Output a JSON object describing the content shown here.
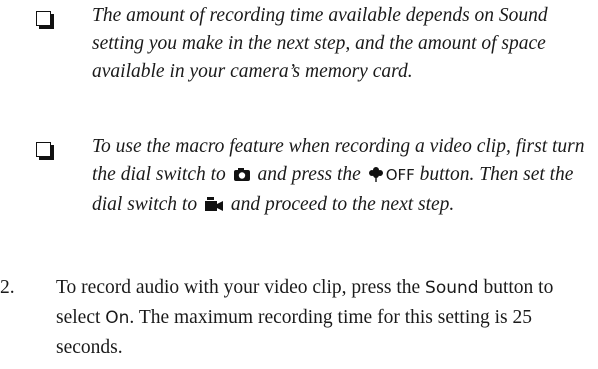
{
  "notes": [
    {
      "text": "The amount of recording time available depends on Sound setting you make in the next step, and the amount of space available in your camera’s memory card."
    },
    {
      "text_before": "To use the macro feature when recording a video clip, first turn the dial switch to",
      "icon_camera": "camera-mode-icon",
      "text_mid": "and press the",
      "icon_macro": "macro-flower-icon",
      "button_label": "OFF",
      "text_after": "button. Then set the dial switch to",
      "icon_video": "video-mode-icon",
      "text_end": "and proceed to the next step."
    }
  ],
  "step": {
    "number": "2.",
    "text_start": "To record audio with your video clip, press the",
    "button": "Sound",
    "text_mid": "button to select",
    "option": "On",
    "text_end": ". The maximum recording time for this setting is 25 seconds."
  }
}
